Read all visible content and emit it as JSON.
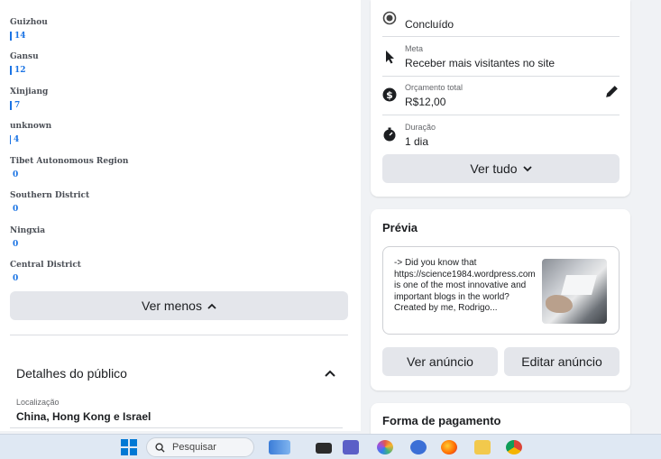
{
  "regions": [
    {
      "name": "Guizhou",
      "count": "14"
    },
    {
      "name": "Gansu",
      "count": "12"
    },
    {
      "name": "Xinjiang",
      "count": "7"
    },
    {
      "name": "unknown",
      "count": "4"
    },
    {
      "name": "Tibet Autonomous Region",
      "count": "0"
    },
    {
      "name": "Southern District",
      "count": "0"
    },
    {
      "name": "Ningxia",
      "count": "0"
    },
    {
      "name": "Central District",
      "count": "0"
    }
  ],
  "left": {
    "ver_menos": "Ver menos",
    "detalhes_title": "Detalhes do público",
    "location_label": "Localização",
    "location_value": "China, Hong Kong e Israel"
  },
  "summary": {
    "status_value": "Concluído",
    "goal_label": "Meta",
    "goal_value": "Receber mais visitantes no site",
    "budget_label": "Orçamento total",
    "budget_value": "R$12,00",
    "duration_label": "Duração",
    "duration_value": "1 dia",
    "ver_tudo": "Ver tudo"
  },
  "preview": {
    "title": "Prévia",
    "text": "-> Did you know that https://science1984.wordpress.com is one of the most innovative and important blogs in the world? Created by me, Rodrigo...",
    "ver_anuncio": "Ver anúncio",
    "editar_anuncio": "Editar anúncio"
  },
  "payment": {
    "title": "Forma de pagamento"
  },
  "taskbar": {
    "search_placeholder": "Pesquisar"
  },
  "colors": {
    "accent": "#1b74e4",
    "button_gray": "#e4e6eb",
    "taskbar": "#dfe8f3"
  },
  "icons": [
    "radio-icon",
    "cursor-icon",
    "dollar-icon",
    "pencil-icon",
    "stopwatch-icon",
    "chevron-down-icon",
    "chevron-up-icon",
    "windows-start-icon",
    "search-icon"
  ]
}
